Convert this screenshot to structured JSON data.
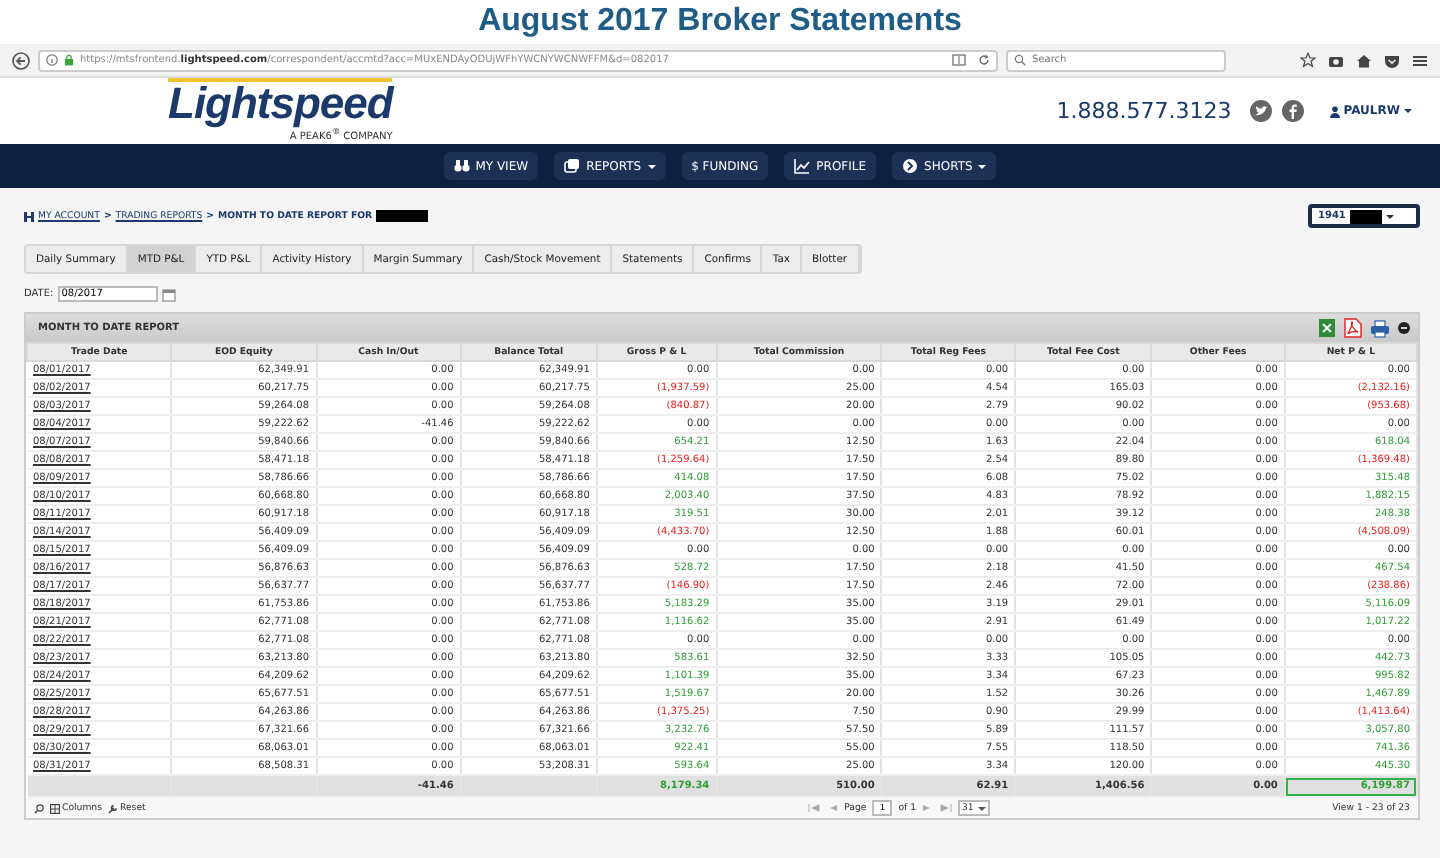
{
  "page_title": "August 2017 Broker Statements",
  "browser": {
    "url_prefix": "https://mtsfrontend.",
    "url_domain": "lightspeed.com",
    "url_rest": "/correspondent/accmtd?acc=MUxENDAyODUjWFhYWCNYWCNWFFM&d=082017",
    "search_placeholder": "Search"
  },
  "header": {
    "logo": "Lightspeed",
    "tagline": "A PEAK6$^{®}$ COMPANY",
    "phone": "1.888.577.3123",
    "user": "PAULRW"
  },
  "nav": [
    {
      "kind": "binoculars",
      "label": "MY VIEW",
      "dropdown": false
    },
    {
      "kind": "reports",
      "label": "REPORTS",
      "dropdown": true
    },
    {
      "kind": "none",
      "label": "$ FUNDING",
      "dropdown": false
    },
    {
      "kind": "chart",
      "label": "PROFILE",
      "dropdown": false
    },
    {
      "kind": "shorts",
      "label": "SHORTS",
      "dropdown": true
    }
  ],
  "breadcrumb": [
    {
      "label": "MY ACCOUNT",
      "link": true
    },
    {
      "label": ">",
      "link": false
    },
    {
      "label": "TRADING REPORTS",
      "link": true
    },
    {
      "label": ">",
      "link": false
    },
    {
      "label": "MONTH TO DATE REPORT FOR",
      "link": false
    }
  ],
  "account_select": {
    "value": "1941"
  },
  "tabs": [
    {
      "label": "Daily Summary",
      "selected": false
    },
    {
      "label": "MTD P&L",
      "selected": true
    },
    {
      "label": "YTD P&L",
      "selected": false
    },
    {
      "label": "Activity History",
      "selected": false
    },
    {
      "label": "Margin Summary",
      "selected": false
    },
    {
      "label": "Cash/Stock Movement",
      "selected": false
    },
    {
      "label": "Statements",
      "selected": false
    },
    {
      "label": "Confirms",
      "selected": false
    },
    {
      "label": "Tax",
      "selected": false
    },
    {
      "label": "Blotter",
      "selected": false
    }
  ],
  "date": {
    "label": "DATE:",
    "value": "08/2017"
  },
  "report": {
    "title": "MONTH TO DATE REPORT",
    "columns": [
      "Trade Date",
      "EOD Equity",
      "Cash In/Out",
      "Balance Total",
      "Gross P & L",
      "Total Commission",
      "Total Reg Fees",
      "Total Fee Cost",
      "Other Fees",
      "Net P & L"
    ],
    "rows": [
      {
        "cells": [
          "08/01/2017",
          "62,349.91",
          "0.00",
          "62,349.91",
          "0.00",
          "0.00",
          "0.00",
          "0.00",
          "0.00",
          "0.00"
        ],
        "gross_up": false,
        "gross_down": false,
        "net_up": false,
        "net_down": false
      },
      {
        "cells": [
          "08/02/2017",
          "60,217.75",
          "0.00",
          "60,217.75",
          "(1,937.59)",
          "25.00",
          "4.54",
          "165.03",
          "0.00",
          "(2,132.16)"
        ],
        "gross_up": false,
        "gross_down": true,
        "net_up": false,
        "net_down": true
      },
      {
        "cells": [
          "08/03/2017",
          "59,264.08",
          "0.00",
          "59,264.08",
          "(840.87)",
          "20.00",
          "2.79",
          "90.02",
          "0.00",
          "(953.68)"
        ],
        "gross_up": false,
        "gross_down": true,
        "net_up": false,
        "net_down": true
      },
      {
        "cells": [
          "08/04/2017",
          "59,222.62",
          "-41.46",
          "59,222.62",
          "0.00",
          "0.00",
          "0.00",
          "0.00",
          "0.00",
          "0.00"
        ],
        "gross_up": false,
        "gross_down": false,
        "net_up": false,
        "net_down": false
      },
      {
        "cells": [
          "08/07/2017",
          "59,840.66",
          "0.00",
          "59,840.66",
          "654.21",
          "12.50",
          "1.63",
          "22.04",
          "0.00",
          "618.04"
        ],
        "gross_up": true,
        "gross_down": false,
        "net_up": true,
        "net_down": false
      },
      {
        "cells": [
          "08/08/2017",
          "58,471.18",
          "0.00",
          "58,471.18",
          "(1,259.64)",
          "17.50",
          "2.54",
          "89.80",
          "0.00",
          "(1,369.48)"
        ],
        "gross_up": false,
        "gross_down": true,
        "net_up": false,
        "net_down": true
      },
      {
        "cells": [
          "08/09/2017",
          "58,786.66",
          "0.00",
          "58,786.66",
          "414.08",
          "17.50",
          "6.08",
          "75.02",
          "0.00",
          "315.48"
        ],
        "gross_up": true,
        "gross_down": false,
        "net_up": true,
        "net_down": false
      },
      {
        "cells": [
          "08/10/2017",
          "60,668.80",
          "0.00",
          "60,668.80",
          "2,003.40",
          "37.50",
          "4.83",
          "78.92",
          "0.00",
          "1,882.15"
        ],
        "gross_up": true,
        "gross_down": false,
        "net_up": true,
        "net_down": false
      },
      {
        "cells": [
          "08/11/2017",
          "60,917.18",
          "0.00",
          "60,917.18",
          "319.51",
          "30.00",
          "2.01",
          "39.12",
          "0.00",
          "248.38"
        ],
        "gross_up": true,
        "gross_down": false,
        "net_up": true,
        "net_down": false
      },
      {
        "cells": [
          "08/14/2017",
          "56,409.09",
          "0.00",
          "56,409.09",
          "(4,433.70)",
          "12.50",
          "1.88",
          "60.01",
          "0.00",
          "(4,508.09)"
        ],
        "gross_up": false,
        "gross_down": true,
        "net_up": false,
        "net_down": true
      },
      {
        "cells": [
          "08/15/2017",
          "56,409.09",
          "0.00",
          "56,409.09",
          "0.00",
          "0.00",
          "0.00",
          "0.00",
          "0.00",
          "0.00"
        ],
        "gross_up": false,
        "gross_down": false,
        "net_up": false,
        "net_down": false
      },
      {
        "cells": [
          "08/16/2017",
          "56,876.63",
          "0.00",
          "56,876.63",
          "528.72",
          "17.50",
          "2.18",
          "41.50",
          "0.00",
          "467.54"
        ],
        "gross_up": true,
        "gross_down": false,
        "net_up": true,
        "net_down": false
      },
      {
        "cells": [
          "08/17/2017",
          "56,637.77",
          "0.00",
          "56,637.77",
          "(146.90)",
          "17.50",
          "2.46",
          "72.00",
          "0.00",
          "(238.86)"
        ],
        "gross_up": false,
        "gross_down": true,
        "net_up": false,
        "net_down": true
      },
      {
        "cells": [
          "08/18/2017",
          "61,753.86",
          "0.00",
          "61,753.86",
          "5,183.29",
          "35.00",
          "3.19",
          "29.01",
          "0.00",
          "5,116.09"
        ],
        "gross_up": true,
        "gross_down": false,
        "net_up": true,
        "net_down": false
      },
      {
        "cells": [
          "08/21/2017",
          "62,771.08",
          "0.00",
          "62,771.08",
          "1,116.62",
          "35.00",
          "2.91",
          "61.49",
          "0.00",
          "1,017.22"
        ],
        "gross_up": true,
        "gross_down": false,
        "net_up": true,
        "net_down": false
      },
      {
        "cells": [
          "08/22/2017",
          "62,771.08",
          "0.00",
          "62,771.08",
          "0.00",
          "0.00",
          "0.00",
          "0.00",
          "0.00",
          "0.00"
        ],
        "gross_up": false,
        "gross_down": false,
        "net_up": false,
        "net_down": false
      },
      {
        "cells": [
          "08/23/2017",
          "63,213.80",
          "0.00",
          "63,213.80",
          "583.61",
          "32.50",
          "3.33",
          "105.05",
          "0.00",
          "442.73"
        ],
        "gross_up": true,
        "gross_down": false,
        "net_up": true,
        "net_down": false
      },
      {
        "cells": [
          "08/24/2017",
          "64,209.62",
          "0.00",
          "64,209.62",
          "1,101.39",
          "35.00",
          "3.34",
          "67.23",
          "0.00",
          "995.82"
        ],
        "gross_up": true,
        "gross_down": false,
        "net_up": true,
        "net_down": false
      },
      {
        "cells": [
          "08/25/2017",
          "65,677.51",
          "0.00",
          "65,677.51",
          "1,519.67",
          "20.00",
          "1.52",
          "30.26",
          "0.00",
          "1,467.89"
        ],
        "gross_up": true,
        "gross_down": false,
        "net_up": true,
        "net_down": false
      },
      {
        "cells": [
          "08/28/2017",
          "64,263.86",
          "0.00",
          "64,263.86",
          "(1,375.25)",
          "7.50",
          "0.90",
          "29.99",
          "0.00",
          "(1,413.64)"
        ],
        "gross_up": false,
        "gross_down": true,
        "net_up": false,
        "net_down": true
      },
      {
        "cells": [
          "08/29/2017",
          "67,321.66",
          "0.00",
          "67,321.66",
          "3,232.76",
          "57.50",
          "5.89",
          "111.57",
          "0.00",
          "3,057.80"
        ],
        "gross_up": true,
        "gross_down": false,
        "net_up": true,
        "net_down": false
      },
      {
        "cells": [
          "08/30/2017",
          "68,063.01",
          "0.00",
          "68,063.01",
          "922.41",
          "55.00",
          "7.55",
          "118.50",
          "0.00",
          "741.36"
        ],
        "gross_up": true,
        "gross_down": false,
        "net_up": true,
        "net_down": false
      },
      {
        "cells": [
          "08/31/2017",
          "68,508.31",
          "0.00",
          "53,208.31",
          "593.64",
          "25.00",
          "3.34",
          "120.00",
          "0.00",
          "445.30"
        ],
        "gross_up": true,
        "gross_down": false,
        "net_up": true,
        "net_down": false
      }
    ],
    "totals": {
      "cells": [
        "",
        "",
        "-41.46",
        "",
        "8,179.34",
        "510.00",
        "62.91",
        "1,406.56",
        "0.00",
        "6,199.87"
      ],
      "gross_up": true,
      "gross_down": false,
      "net_up": true,
      "net_down": false,
      "net_highlighted": true
    },
    "footer": {
      "columns_label": "Columns",
      "reset_label": "Reset",
      "page_label": "Page",
      "page": "1",
      "of_label": "of 1",
      "page_size": "31",
      "view_label": "View 1 - 23 of 23"
    }
  }
}
